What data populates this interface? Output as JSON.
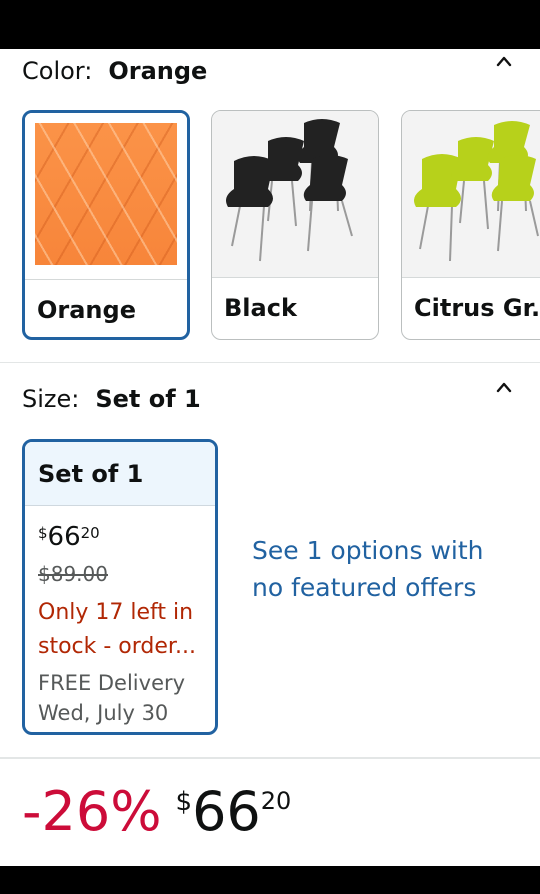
{
  "color": {
    "label": "Color:",
    "value": "Orange",
    "options": [
      {
        "name": "Orange",
        "selected": true
      },
      {
        "name": "Black",
        "selected": false
      },
      {
        "name": "Citrus Gr..",
        "selected": false
      }
    ]
  },
  "size": {
    "label": "Size:",
    "value": "Set of 1",
    "option": {
      "title": "Set of 1",
      "price_symbol": "$",
      "price_whole": "66",
      "price_cents": "20",
      "was_price": "$89.00",
      "stock_line1": "Only 17 left in",
      "stock_line2": "stock - order...",
      "delivery_line1": "FREE Delivery",
      "delivery_line2": "Wed, July 30"
    },
    "see_options": "See 1 options with no featured offers"
  },
  "price": {
    "discount": "-26%",
    "symbol": "$",
    "whole": "66",
    "cents": "20"
  },
  "icons": {
    "collapse": "chevron-up-icon"
  },
  "colors": {
    "accent": "#2162a1",
    "discount": "#cc0c39",
    "stock": "#b12704",
    "selected_bg": "#edf6fd"
  }
}
